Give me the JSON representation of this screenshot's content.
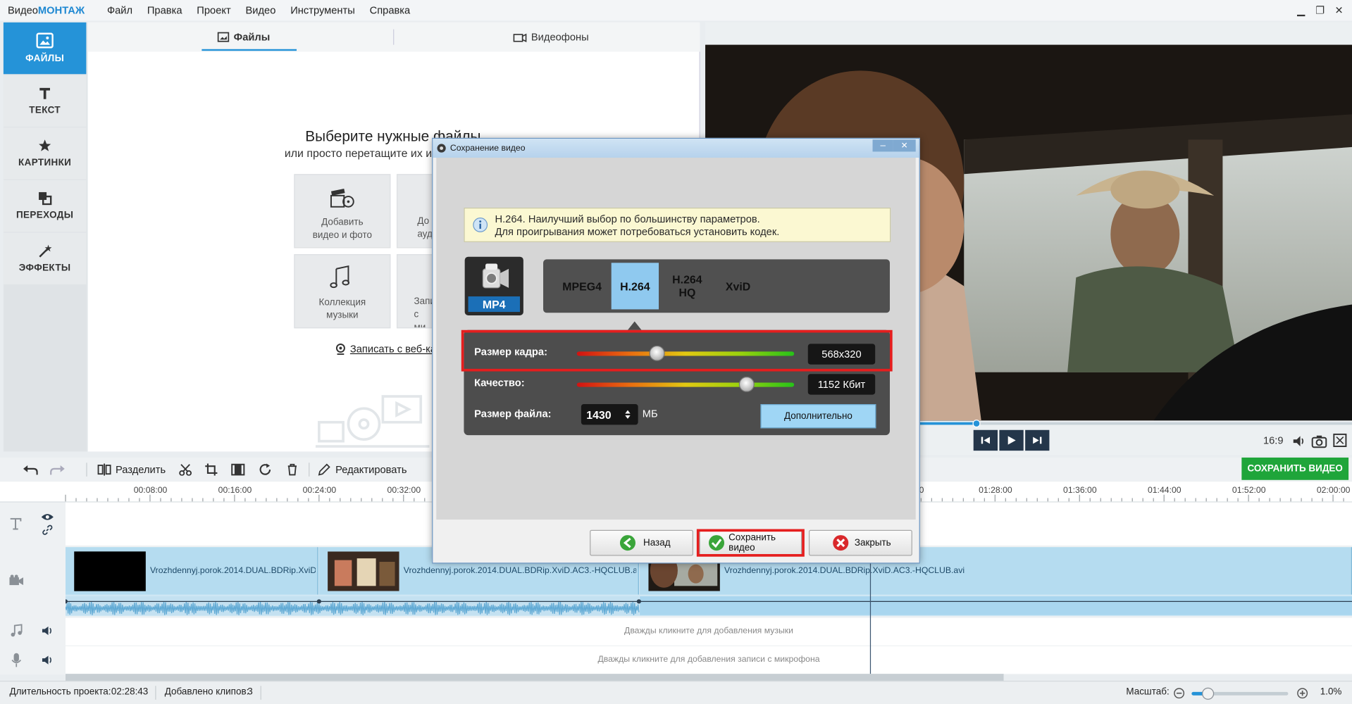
{
  "app": {
    "logo_a": "Видео",
    "logo_b": "МОНТАЖ"
  },
  "menu": [
    "Файл",
    "Правка",
    "Проект",
    "Видео",
    "Инструменты",
    "Справка"
  ],
  "window_controls": {
    "minimize": "▁",
    "restore": "❐",
    "close": "✕"
  },
  "sidebar": {
    "items": [
      {
        "label": "ФАЙЛЫ",
        "icon": "image-icon",
        "active": true
      },
      {
        "label": "ТЕКСТ",
        "icon": "text-icon",
        "active": false
      },
      {
        "label": "КАРТИНКИ",
        "icon": "star-icon",
        "active": false
      },
      {
        "label": "ПЕРЕХОДЫ",
        "icon": "transitions-icon",
        "active": false
      },
      {
        "label": "ЭФФЕКТЫ",
        "icon": "magic-wand-icon",
        "active": false
      }
    ]
  },
  "files_panel": {
    "tabs": [
      {
        "label": "Файлы",
        "icon": "image-icon"
      },
      {
        "label": "Видеофоны",
        "icon": "video-bg-icon"
      }
    ],
    "heading": "Выберите нужные файлы",
    "subheading": "или просто перетащите их и",
    "tiles": [
      {
        "line1": "Добавить",
        "line2": "видео и фото",
        "icon": "film-reel-icon"
      },
      {
        "line1": "До",
        "line2": "ауд",
        "icon": ""
      },
      {
        "line1": "Коллекция",
        "line2": "музыки",
        "icon": "music-notes-icon"
      },
      {
        "line1": "Запи",
        "line2": "с ми",
        "icon": ""
      }
    ],
    "webcam_link": "Записать с веб-кам"
  },
  "preview": {
    "aspect": "16:9",
    "progress": 0.42
  },
  "toolbar": {
    "split": "Разделить",
    "edit": "Редактировать",
    "save_video": "СОХРАНИТЬ ВИДЕО"
  },
  "timeline": {
    "ticks": [
      "00:08:00",
      "00:16:00",
      "00:24:00",
      "00:32:00",
      "0",
      "01:28:00",
      "01:36:00",
      "01:44:00",
      "01:52:00",
      "02:00:00"
    ],
    "clips": [
      "Vrozhdennyj.porok.2014.DUAL.BDRip.XviD",
      "Vrozhdennyj.porok.2014.DUAL.BDRip.XviD.AC3.-HQCLUB.a",
      "Vrozhdennyj.porok.2014.DUAL.BDRip.XviD.AC3.-HQCLUB.avi"
    ],
    "music_hint": "Дважды кликните для добавления музыки",
    "mic_hint": "Дважды кликните для добавления записи с микрофона"
  },
  "status": {
    "duration_label": "Длительность проекта:",
    "duration_value": "02:28:43",
    "clips_label": "Добавлено клипов:",
    "clips_value": "3",
    "zoom_label": "Масштаб:",
    "zoom_value": "1.0%",
    "zoom_level": 0.17
  },
  "dialog": {
    "title": "Сохранение видео",
    "minimize": "–",
    "close": "✕",
    "info_line1": "H.264. Наилучший выбор по большинству параметров.",
    "info_line2": "Для проигрывания может потребоваться установить кодек.",
    "format_label": "MP4",
    "codecs": [
      "MPEG4",
      "H.264",
      "H.264\nHQ",
      "XviD"
    ],
    "selected_codec": "H.264",
    "frame_size_label": "Размер кадра:",
    "frame_size_value": "568x320",
    "frame_size_level": 0.37,
    "quality_label": "Качество:",
    "quality_value": "1152 Кбит",
    "quality_level": 0.78,
    "file_size_label": "Размер файла:",
    "file_size_value": "1430",
    "file_size_unit": "МБ",
    "advanced_button": "Дополнительно",
    "back_button": "Назад",
    "save_button": "Сохранить видео",
    "close_button": "Закрыть"
  },
  "colors": {
    "accent": "#2593d8",
    "save_green": "#1fa53a",
    "highlight_red": "#e51e1e",
    "codec_selected": "#8fc9ef"
  }
}
